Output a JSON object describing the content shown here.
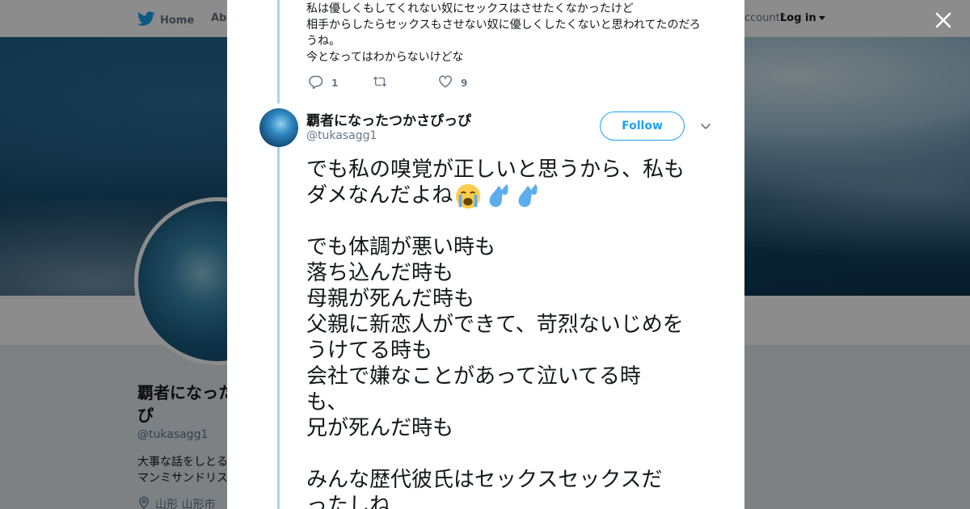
{
  "nav": {
    "home": "Home",
    "about": "Abo",
    "account": "ccount?",
    "login": "Log in"
  },
  "profile": {
    "name": "覇者になった\nぴ",
    "handle": "@tukasagg1",
    "bio_line1": "大事な話をしとる",
    "bio_line2": "マンミサンドリス",
    "location": "山形 山形市"
  },
  "thread_prev": {
    "lines": [
      "私は優しくもしてくれない奴にセックスはさせたくなかったけど",
      "相手からしたらセックスもさせない奴に優しくしたくないと思われてたのだろ",
      "うね。",
      "今となってはわからないけどな"
    ],
    "reply_count": "1",
    "retweet_count": "",
    "like_count": "9"
  },
  "tweet": {
    "author_name": "覇者になったつかさぴっぴ",
    "author_handle": "@tukasagg1",
    "follow_label": "Follow",
    "lines": [
      "でも私の嗅覚が正しいと思うから、私も",
      "ダメなんだよね",
      "",
      "でも体調が悪い時も",
      "落ち込んだ時も",
      "母親が死んだ時も",
      "父親に新恋人ができて、苛烈ないじめを",
      "うけてる時も",
      "会社で嫌なことがあって泣いてる時",
      "も、",
      "兄が死んだ時も",
      "",
      "みんな歴代彼氏はセックスセックスだ",
      "ったしね"
    ]
  },
  "icons": {
    "logo": "twitter-bird-icon",
    "close": "close-icon",
    "reply": "reply-icon",
    "retweet": "retweet-icon",
    "like": "heart-icon",
    "more": "chevron-down-icon",
    "location": "location-pin-icon",
    "emoji": [
      "loudly-crying-face-emoji",
      "sweat-droplets-emoji",
      "sweat-droplets-emoji"
    ]
  },
  "colors": {
    "accent": "#1da1f2",
    "thread_line": "#a5d4f5",
    "text": "#14171a",
    "muted": "#657786"
  }
}
